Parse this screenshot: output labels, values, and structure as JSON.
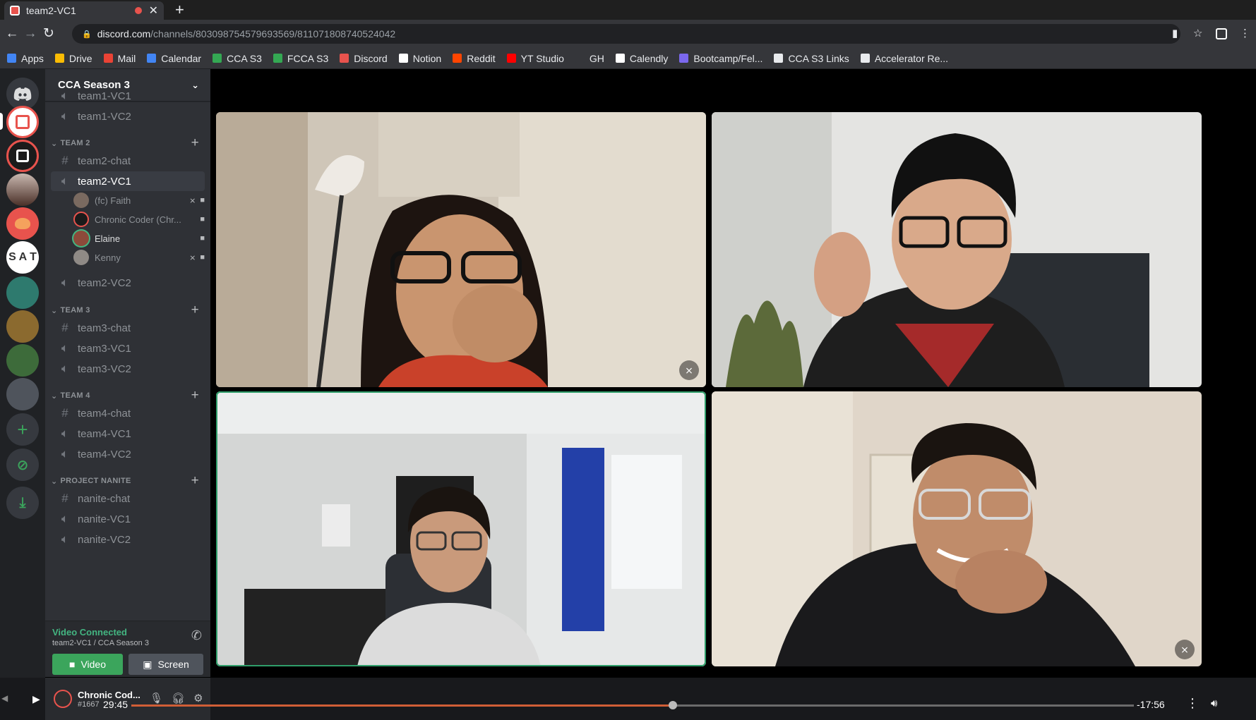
{
  "browser": {
    "tab_title": "team2-VC1",
    "url_host": "discord.com",
    "url_path": "/channels/803098754579693569/811071808740524042",
    "bookmarks": [
      {
        "label": "Apps",
        "color": "#4285f4"
      },
      {
        "label": "Drive",
        "color": "#fbbc04"
      },
      {
        "label": "Mail",
        "color": "#ea4335"
      },
      {
        "label": "Calendar",
        "color": "#4285f4"
      },
      {
        "label": "CCA S3",
        "color": "#34a853"
      },
      {
        "label": "FCCA S3",
        "color": "#34a853"
      },
      {
        "label": "Discord",
        "color": "#e8534d"
      },
      {
        "label": "Notion",
        "color": "#ffffff"
      },
      {
        "label": "Reddit",
        "color": "#ff4500"
      },
      {
        "label": "YT Studio",
        "color": "#ff0000"
      },
      {
        "label": "GH",
        "color": "#35363a"
      },
      {
        "label": "Calendly",
        "color": "#ffffff"
      },
      {
        "label": "Bootcamp/Fel...",
        "color": "#7b68ee"
      },
      {
        "label": "CCA S3 Links",
        "color": "#e8eaed"
      },
      {
        "label": "Accelerator Re...",
        "color": "#e8eaed"
      }
    ]
  },
  "server": {
    "name": "CCA Season 3",
    "channels": {
      "team1_vc1": "team1-VC1",
      "team1_vc2": "team1-VC2",
      "team2_cat": "TEAM 2",
      "team2_chat": "team2-chat",
      "team2_vc1": "team2-VC1",
      "team2_vc2": "team2-VC2",
      "team3_cat": "TEAM 3",
      "team3_chat": "team3-chat",
      "team3_vc1": "team3-VC1",
      "team3_vc2": "team3-VC2",
      "team4_cat": "TEAM 4",
      "team4_chat": "team4-chat",
      "team4_vc1": "team4-VC1",
      "team4_vc2": "team4-VC2",
      "nanite_cat": "PROJECT NANITE",
      "nanite_chat": "nanite-chat",
      "nanite_vc1": "nanite-VC1",
      "nanite_vc2": "nanite-VC2"
    },
    "voice_members": [
      {
        "name": "(fc) Faith",
        "muted": true,
        "video": true
      },
      {
        "name": "Chronic Coder (Chr...",
        "muted": false,
        "video": true
      },
      {
        "name": "Elaine",
        "muted": false,
        "video": true
      },
      {
        "name": "Kenny",
        "muted": true,
        "video": true
      }
    ]
  },
  "guild_rail": {
    "sat_label": "S A T"
  },
  "voice_panel": {
    "status": "Video Connected",
    "location": "team2-VC1 / CCA Season 3",
    "video_label": "Video",
    "screen_label": "Screen"
  },
  "user": {
    "name": "Chronic Cod...",
    "tag": "#1667"
  },
  "player": {
    "elapsed": "29:45",
    "remaining": "-17:56",
    "progress_fraction": 0.54
  },
  "colors": {
    "accent_green": "#43b581",
    "speaking_outline": "#2f9e6a",
    "progress": "#d05e36"
  }
}
